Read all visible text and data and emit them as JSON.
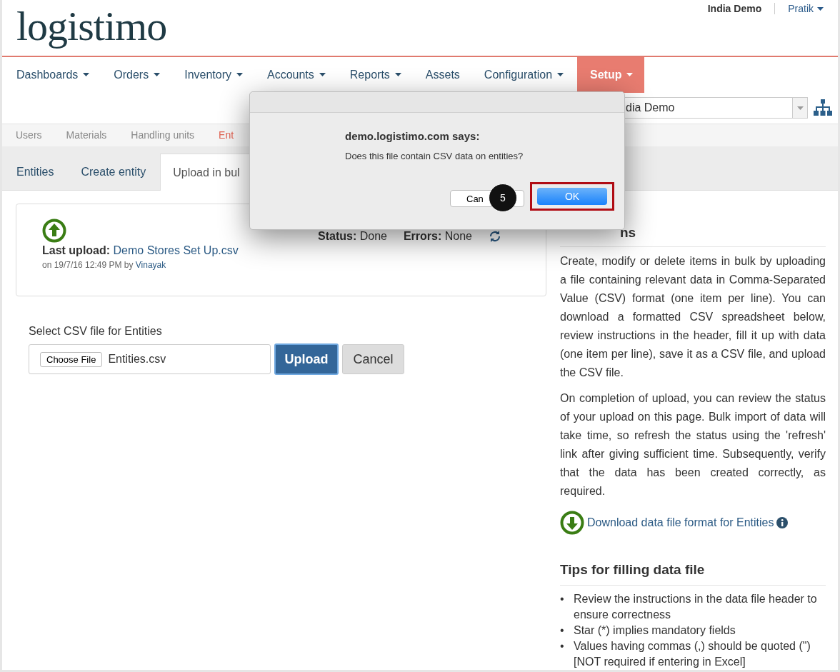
{
  "header": {
    "logo": "logistimo",
    "domain": "India Demo",
    "user": "Pratik"
  },
  "nav": [
    {
      "label": "Dashboards",
      "has_menu": true,
      "selected": false
    },
    {
      "label": "Orders",
      "has_menu": true,
      "selected": false
    },
    {
      "label": "Inventory",
      "has_menu": true,
      "selected": false
    },
    {
      "label": "Accounts",
      "has_menu": true,
      "selected": false
    },
    {
      "label": "Reports",
      "has_menu": true,
      "selected": false
    },
    {
      "label": "Assets",
      "has_menu": false,
      "selected": false
    },
    {
      "label": "Configuration",
      "has_menu": true,
      "selected": false
    },
    {
      "label": "Setup",
      "has_menu": true,
      "selected": true
    }
  ],
  "domain_select": {
    "value": "dia Demo"
  },
  "subtabs": [
    {
      "label": "Users",
      "selected": false
    },
    {
      "label": "Materials",
      "selected": false
    },
    {
      "label": "Handling units",
      "selected": false
    },
    {
      "label": "Ent",
      "selected": true
    }
  ],
  "tabs": [
    {
      "label": "Entities",
      "selected": false
    },
    {
      "label": "Create entity",
      "selected": false
    },
    {
      "label": "Upload in bul",
      "selected": true
    }
  ],
  "upload_status": {
    "status": "**Status:** Done",
    "errors": "**Errors:** None",
    "last_upload": "**Last upload:** ",
    "file": "Demo Stores Set Up.csv",
    "meta": "on 19/7/16 12:49 PM by ",
    "user": "Vinayak"
  },
  "form": {
    "label": "Select CSV file for Entities",
    "choose_button": "Choose File",
    "file_name": "Entities.csv",
    "upload_button": "Upload",
    "cancel_button": "Cancel"
  },
  "instructions": {
    "title": "ns",
    "paragraphs": [
      "Create, modify or delete items in bulk by uploading a file containing relevant data in Comma-Separated Value (CSV) format (one item per line). You can download a formatted CSV spreadsheet below, review instructions in the header, fill it up with data (one item per line), save it as a CSV file, and upload the CSV file.",
      "On completion of upload, you can review the status of your upload on this page. Bulk import of data will take time, so refresh the status using the 'refresh' link after giving sufficient time. Subsequently, verify that the data has been created correctly, as required."
    ],
    "download_link": "Download data file format for Entities"
  },
  "tips": {
    "title": "Tips for filling data file",
    "bullet": "•",
    "items": [
      "Review the instructions in the data file header to ensure correctness",
      "Star (*) implies mandatory fields",
      "Values having commas (,) should be quoted (\") [NOT required if entering in Excel]"
    ]
  },
  "dialog": {
    "title": "demo.logistimo.com says:",
    "message": "Does this file contain CSV data on entities?",
    "cancel_button": "Can",
    "ok_button": "OK",
    "step": "5"
  }
}
